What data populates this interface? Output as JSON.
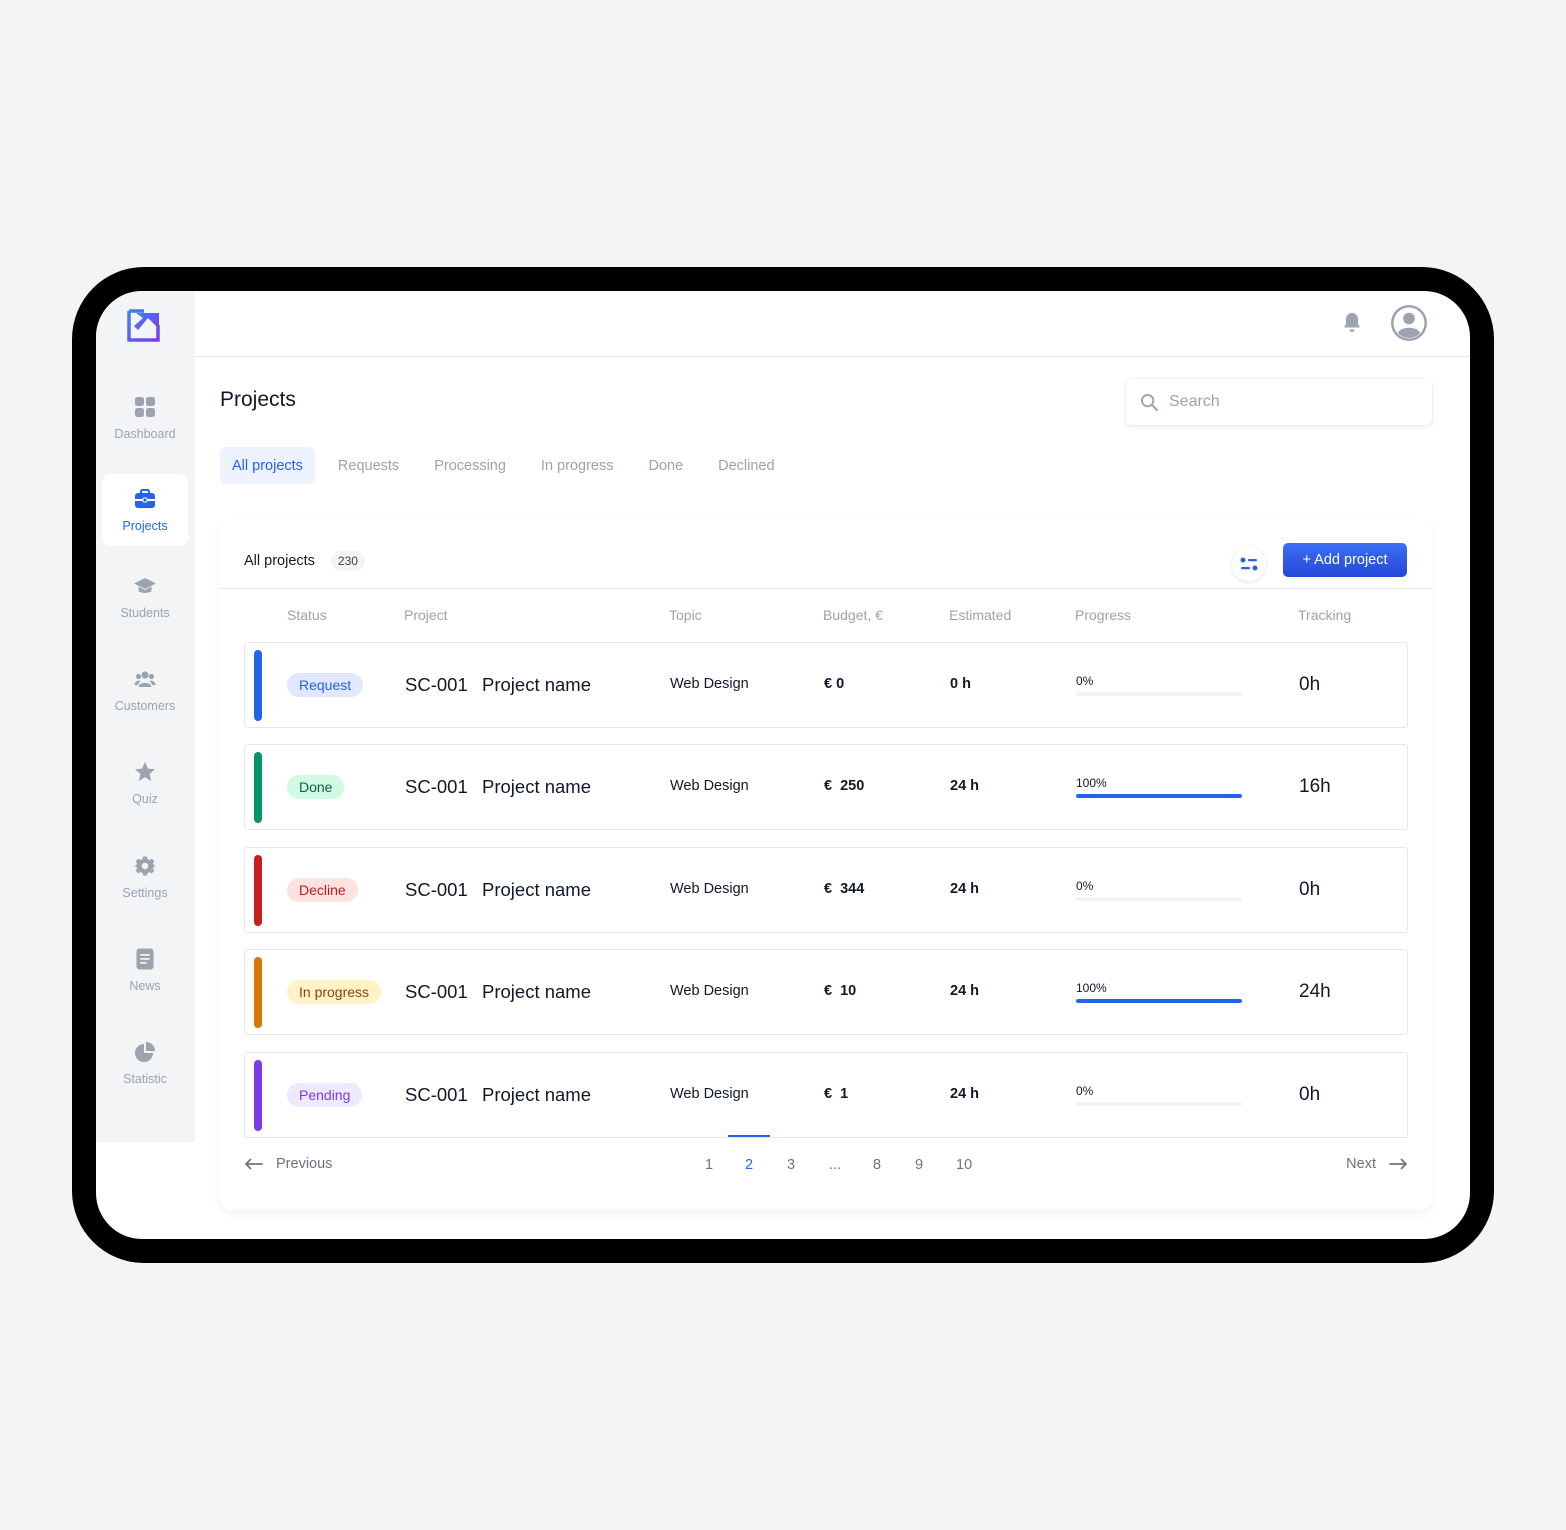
{
  "app": {
    "logo_icon": "edit-square-logo-icon",
    "accent_color": "#2563eb"
  },
  "sidebar": {
    "items": [
      {
        "label": "Dashboard",
        "icon": "grid-icon"
      },
      {
        "label": "Projects",
        "icon": "briefcase-icon",
        "active": true
      },
      {
        "label": "Students",
        "icon": "graduation-cap-icon"
      },
      {
        "label": "Customers",
        "icon": "users-icon"
      },
      {
        "label": "Quiz",
        "icon": "star-icon"
      },
      {
        "label": "Settings",
        "icon": "gear-icon"
      },
      {
        "label": "News",
        "icon": "document-icon"
      },
      {
        "label": "Statistic",
        "icon": "pie-chart-icon"
      }
    ]
  },
  "header": {
    "bell_icon": "bell-icon",
    "avatar_icon": "user-avatar-icon"
  },
  "page": {
    "title": "Projects",
    "search_placeholder": "Search"
  },
  "tabs": [
    {
      "label": "All projects",
      "active": true
    },
    {
      "label": "Requests"
    },
    {
      "label": "Processing"
    },
    {
      "label": "In progress"
    },
    {
      "label": "Done"
    },
    {
      "label": "Declined"
    }
  ],
  "card": {
    "title": "All projects",
    "count": "230",
    "filter_icon": "filter-sliders-icon",
    "add_button": "+ Add project"
  },
  "table": {
    "headers": {
      "status": "Status",
      "project": "Project",
      "topic": "Topic",
      "budget": "Budget, €",
      "estimated": "Estimated",
      "progress": "Progress",
      "tracking": "Tracking"
    },
    "rows": [
      {
        "status": "Request",
        "status_color": "#2563eb",
        "status_bg": "#e0e7ff",
        "status_text": "#2563eb",
        "code": "SC-001",
        "name": "Project name",
        "topic": "Web Design",
        "budget": "€ 0",
        "estimated": "0 h",
        "progress_label": "0%",
        "progress": 0,
        "tracking": "0h"
      },
      {
        "status": "Done",
        "status_color": "#059669",
        "status_bg": "#d1fae5",
        "status_text": "#065f46",
        "code": "SC-001",
        "name": "Project name",
        "topic": "Web Design",
        "budget": "€  250",
        "estimated": "24 h",
        "progress_label": "100%",
        "progress": 100,
        "tracking": "16h"
      },
      {
        "status": "Decline",
        "status_color": "#c81e1e",
        "status_bg": "#fde2e2",
        "status_text": "#b91c1c",
        "code": "SC-001",
        "name": "Project name",
        "topic": "Web Design",
        "budget": "€  344",
        "estimated": "24 h",
        "progress_label": "0%",
        "progress": 0,
        "tracking": "0h"
      },
      {
        "status": "In progress",
        "status_color": "#d97706",
        "status_bg": "#fef3c7",
        "status_text": "#92400e",
        "code": "SC-001",
        "name": "Project name",
        "topic": "Web Design",
        "budget": "€  10",
        "estimated": "24 h",
        "progress_label": "100%",
        "progress": 100,
        "tracking": "24h"
      },
      {
        "status": "Pending",
        "status_color": "#7c3aed",
        "status_bg": "#ede9fe",
        "status_text": "#7c3aed",
        "code": "SC-001",
        "name": "Project name",
        "topic": "Web Design",
        "budget": "€  1",
        "estimated": "24 h",
        "progress_label": "0%",
        "progress": 0,
        "tracking": "0h"
      }
    ]
  },
  "pagination": {
    "previous": "Previous",
    "next": "Next",
    "pages": [
      "1",
      "2",
      "3",
      "...",
      "8",
      "9",
      "10"
    ],
    "current": "2"
  }
}
